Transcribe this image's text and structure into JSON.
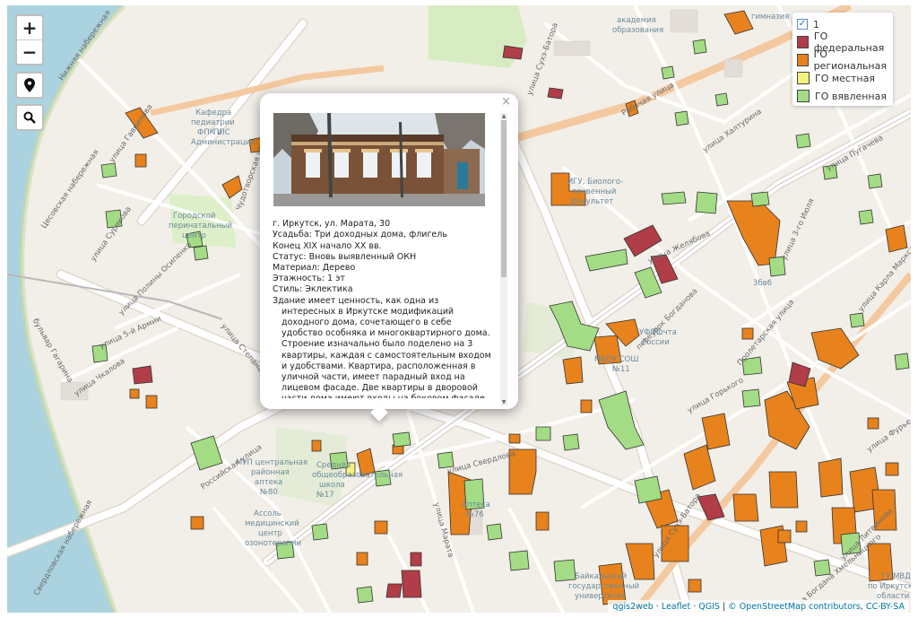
{
  "map": {
    "controls": {
      "zoom_in": "+",
      "zoom_out": "−"
    },
    "legend": {
      "items": [
        {
          "label": "1",
          "type": "checkbox",
          "checked": true
        },
        {
          "label": "ГО федеральная",
          "color": "#b03d47"
        },
        {
          "label": "ГО региональная",
          "color": "#e8821c"
        },
        {
          "label": "ГО местная",
          "color": "#f2f27c"
        },
        {
          "label": "ГО вявленная",
          "color": "#a3dc84"
        }
      ]
    },
    "popup": {
      "close": "×",
      "photo_alt": "Фото здания",
      "lines": [
        "г. Иркутск, ул. Марата, 30",
        "Усадьба: Три доходных дома, флигель",
        "Конец XIX начало XX вв.",
        "Статус: Вновь выявленный ОКН",
        "Материал: Дерево",
        "Этажность: 1 эт",
        "Стиль: Эклектика"
      ],
      "description": "Здание имеет ценность, как одна из интересных в Иркутске модификаций доходного дома, сочетающего в себе удобство особняка и многоквартирного дома. Строение изначально было поделено на 3 квартиры, каждая с самостоятельным входом и удобствами. Квартира, расположенная в уличной части, имеет парадный вход на лицевом фасаде. Две квартиры в дворовой части дома имеют входы на боковом фасаде со стороны общего двора. Дополнительные входы в каждую квартиру"
    },
    "attribution": {
      "qgis2web": "qgis2web",
      "leaflet": "Leaflet",
      "qgis": "QGIS",
      "osm": "© OpenStreetMap contributors",
      "license": "CC-BY-SA",
      "sep": " · ",
      "sep2": " | ",
      "sep3": ", "
    },
    "labels": {
      "l1": "Кафедра",
      "l2": "педиатрии",
      "l3": "ФПК и",
      "l4": "ППС",
      "l5": "Администрация",
      "l6": "Городской",
      "l7": "перинатальный",
      "l8": "центр",
      "l9": "ИГУ, Биолого-",
      "l10": "почвенный",
      "l11": "факультет",
      "l12": "МБОУ СОШ",
      "l13": "№11",
      "l14": "УФПС",
      "l15": "Почта",
      "l16": "России",
      "l17": "МУП центральная",
      "l18": "районная",
      "l19": "аптека",
      "l20": "№80",
      "l21": "Средняя",
      "l22": "общеобразовательная",
      "l23": "школа",
      "l24": "№17",
      "l25": "Аптека",
      "l26": "№76",
      "l27": "Ассоль",
      "l28": "медицинский",
      "l29": "центр",
      "l30": "озонотерапии",
      "l31": "Байкальский",
      "l32": "государственный",
      "l33": "университет",
      "l34": "ГУ МВД",
      "l35": "по Иркутской",
      "l36": "области",
      "l37": "академия",
      "l38": "образования",
      "l39": "гимназия",
      "l40": "3бв6",
      "s1": "улица Гаврилова",
      "s2": "улица Сурикова",
      "s3": "улица Полины Осипенко",
      "s4": "улица 5-й Армии",
      "s5": "улица Чкалова",
      "s6": "бульвар Гагарина",
      "s7": "Российская улица",
      "s8": "улица Степана Разина",
      "s9": "улица Сухэ-Батора",
      "s10": "улица Желябова",
      "s11": "улица Свердлова",
      "s12": "улица Горького",
      "s13": "переулок Богданова",
      "s14": "Пролетарская улица",
      "s15": "улица Карла Маркса",
      "s16": "улица Фурье",
      "s17": "улица Литвинова",
      "s18": "улица Богдана Хмельницкого",
      "s19": "Рабочая улица",
      "s20": "Цесовская набережная",
      "s21": "улица Марата",
      "s22": "улица Сухэ-Батора",
      "s23": "улица Халтурина",
      "s24": "улица 3-го Июля",
      "s25": "улица Пугачева",
      "s26": "Нижняя набережная",
      "s27": "Чудотворская улица",
      "s28": "Свердловская набережная"
    }
  }
}
